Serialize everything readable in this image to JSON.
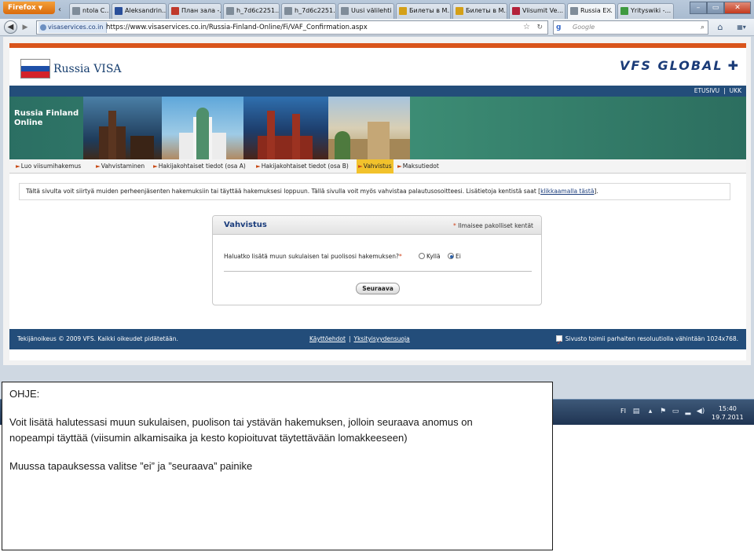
{
  "browser": {
    "app_button": "Firefox",
    "tabs": [
      {
        "label": "ntola C...",
        "icon": "page-icon",
        "color": "#7f8c99"
      },
      {
        "label": "Aleksandrin...",
        "icon": "site-icon",
        "color": "#2a4f9a"
      },
      {
        "label": "План зала -...",
        "icon": "site-icon",
        "color": "#c0392b"
      },
      {
        "label": "h_7d6c2251...",
        "icon": "page-icon",
        "color": "#7f8c99"
      },
      {
        "label": "h_7d6c2251...",
        "icon": "page-icon",
        "color": "#7f8c99"
      },
      {
        "label": "Uusi välilehti",
        "icon": "page-icon",
        "color": "#7f8c99"
      },
      {
        "label": "Билеты в М...",
        "icon": "crown-icon",
        "color": "#d4a018"
      },
      {
        "label": "Билеты в М...",
        "icon": "crown-icon",
        "color": "#d4a018"
      },
      {
        "label": "Viisumit Ve...",
        "icon": "site-icon",
        "color": "#b3213a"
      },
      {
        "label": "Russia E...",
        "icon": "page-icon",
        "color": "#7f8c99",
        "active": true
      },
      {
        "label": "Yrityswiki -...",
        "icon": "check-icon",
        "color": "#3f9a3f"
      }
    ],
    "site_identity": "visaservices.co.in",
    "url": "https://www.visaservices.co.in/Russia-Finland-Online/Fi/VAF_Confirmation.aspx",
    "search_engine_letter": "g",
    "search_placeholder": "Google"
  },
  "page": {
    "brand": "Russia VISA",
    "vfs_logo": "VFS GLOBAL",
    "topnav": [
      "ETUSIVU",
      "UKK"
    ],
    "banner_title": "Russia Finland Online",
    "breadcrumbs": [
      {
        "label": "Luo viisumihakemus"
      },
      {
        "label": "Vahvistaminen"
      },
      {
        "label": "Hakijakohtaiset tiedot (osa A)"
      },
      {
        "label": "Hakijakohtaiset tiedot (osa B)"
      },
      {
        "label": "Vahvistus",
        "active": true
      },
      {
        "label": "Maksutiedot"
      }
    ],
    "info_text": "Tältä sivulta voit siirtyä muiden perheenjäsenten hakemuksiin tai täyttää hakemuksesi loppuun. Tällä sivulla voit myös vahvistaa palautusosoitteesi. Lisätietoja kentistä saat [",
    "info_link": "klikkaamalla tästä",
    "info_end": "].",
    "form": {
      "title": "Vahvistus",
      "required_mark": "*",
      "required_note": "Ilmaisee pakolliset kentät",
      "question": "Haluatko lisätä muun sukulaisen tai puolisosi hakemuksen?",
      "options": [
        {
          "label": "Kyllä",
          "selected": false
        },
        {
          "label": "Ei",
          "selected": true
        }
      ],
      "next_button": "Seuraava"
    },
    "footer": {
      "copyright": "Tekijänoikeus © 2009 VFS. Kaikki oikeudet pidätetään.",
      "links": [
        "Käyttöehdot",
        "Yksityisyydensuoja"
      ],
      "resolution_note": "Sivusto toimii parhaiten resoluutiolla vähintään 1024x768."
    }
  },
  "taskbar": {
    "lang": "FI",
    "time": "15:40",
    "date": "19.7.2011"
  },
  "instruction": {
    "title": "OHJE:",
    "line1": "Voit lisätä halutessasi muun sukulaisen, puolison tai ystävän hakemuksen, jolloin seuraava anomus on",
    "line2": "nopeampi täyttää (viisumin alkamisaika ja kesto kopioituvat täytettävään lomakkeeseen)",
    "line3": "Muussa tapauksessa valitse ”ei” ja ”seuraava” painike"
  },
  "colors": {
    "accent_orange": "#d9541b",
    "nav_blue": "#234d7a",
    "highlight_yellow": "#f2c22c"
  }
}
